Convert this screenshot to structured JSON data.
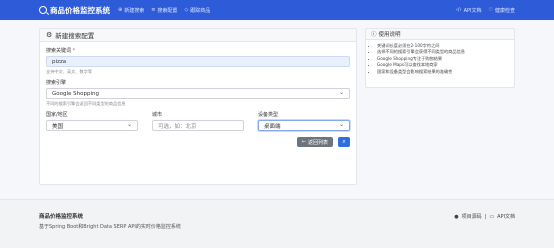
{
  "navbar": {
    "brand": "商品价格监控系统",
    "links": [
      {
        "icon": "plus-circle-icon",
        "label": "新建搜索"
      },
      {
        "icon": "list-icon",
        "label": "搜索配置"
      },
      {
        "icon": "tag-icon",
        "label": "跟踪商品"
      }
    ],
    "right": [
      {
        "icon": "code-icon",
        "label": "API文档"
      },
      {
        "icon": "health-icon",
        "label": "健康检查"
      }
    ]
  },
  "form": {
    "header": "新建搜索配置",
    "keyword_label": "搜索关键词",
    "keyword_required": "*",
    "keyword_value": "pizza",
    "keyword_help": "支持中文、英文、数字等",
    "engine_label": "搜索引擎",
    "engine_value": "Google Shopping",
    "engine_help": "不同的搜索引擎会返回不同类型的商品信息",
    "country_label": "国家/地区",
    "country_value": "美国",
    "city_label": "城市",
    "city_placeholder": "可选，如：北京",
    "device_label": "设备类型",
    "device_value": "桌面端",
    "back_label": "返回列表",
    "back_icon": "arrow-left-icon",
    "search_icon": "search-icon"
  },
  "help_card": {
    "header": "使用说明",
    "items": [
      "关键词长度必须在2-100字符之间",
      "选择不同的搜索引擎会获得不同类型的商品信息",
      "Google Shopping专注于购物结果",
      "Google Maps可以查找本地商家",
      "国家和设备类型会影响搜索结果的准确性"
    ]
  },
  "footer": {
    "title": "商品价格监控系统",
    "subtitle": "基于Spring Boot和Bright Data SERP API的实时价格监控系统",
    "link_code": "项目源码",
    "separator": "|",
    "link_api": "API文档"
  },
  "colors": {
    "primary": "#2e5bd8",
    "button": "#2e6fe0",
    "back": "#6c757d"
  }
}
